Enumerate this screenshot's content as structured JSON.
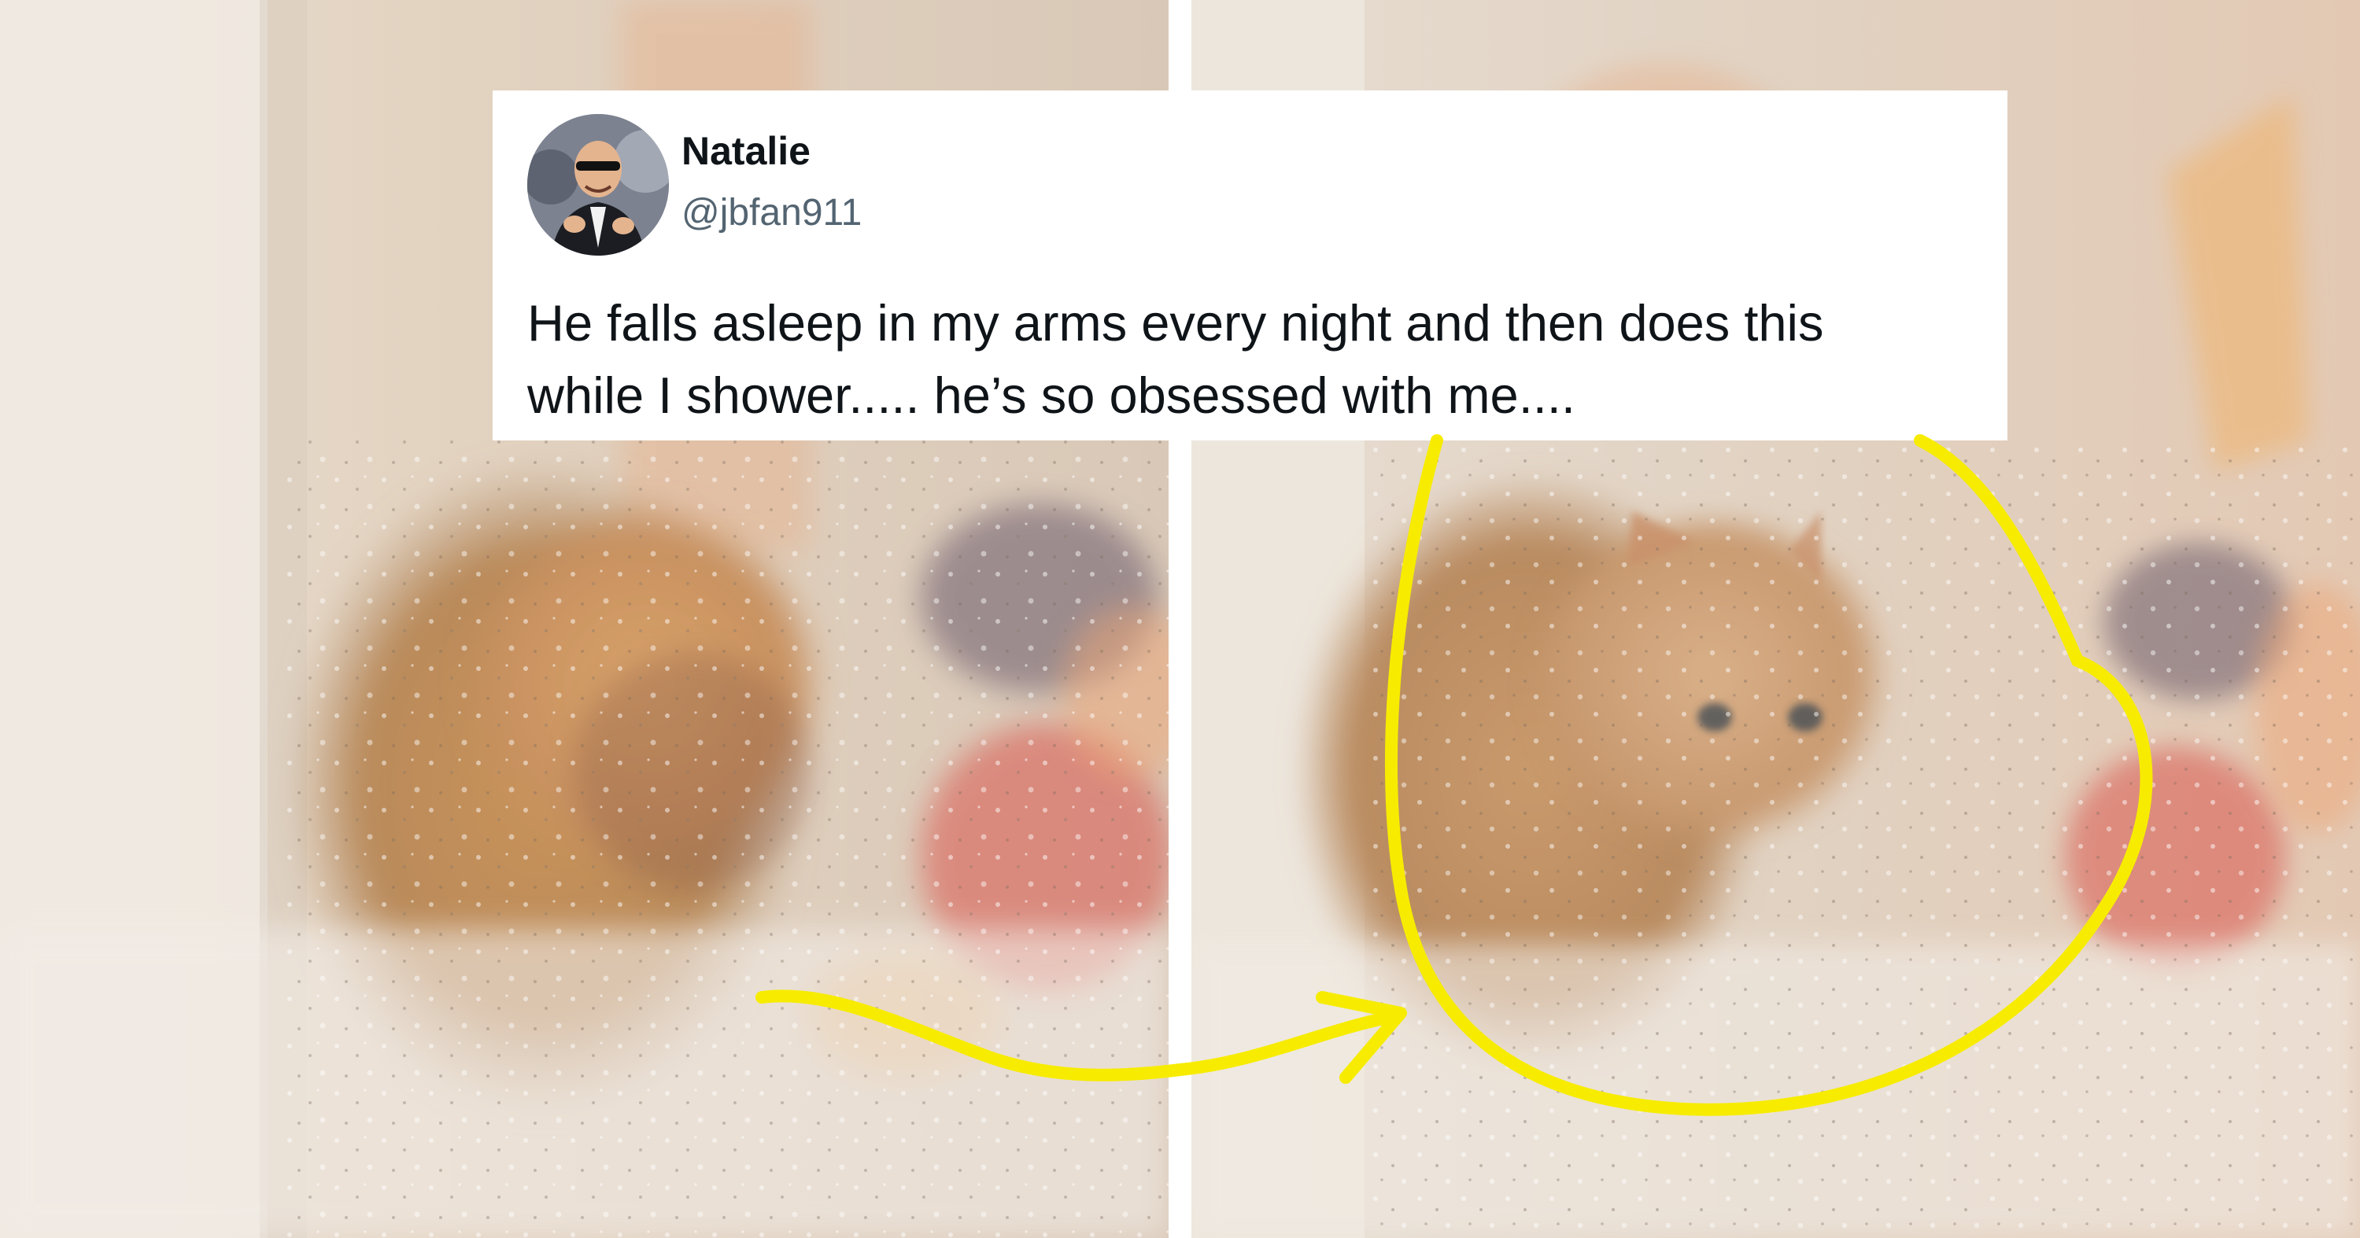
{
  "tweet": {
    "display_name": "Natalie",
    "handle": "@jbfan911",
    "text_line_1": "He falls asleep in my arms every night and then does this",
    "text_line_2": "while I shower..... he’s so obsessed with me...."
  },
  "annotation": {
    "color": "#f7ec00"
  }
}
